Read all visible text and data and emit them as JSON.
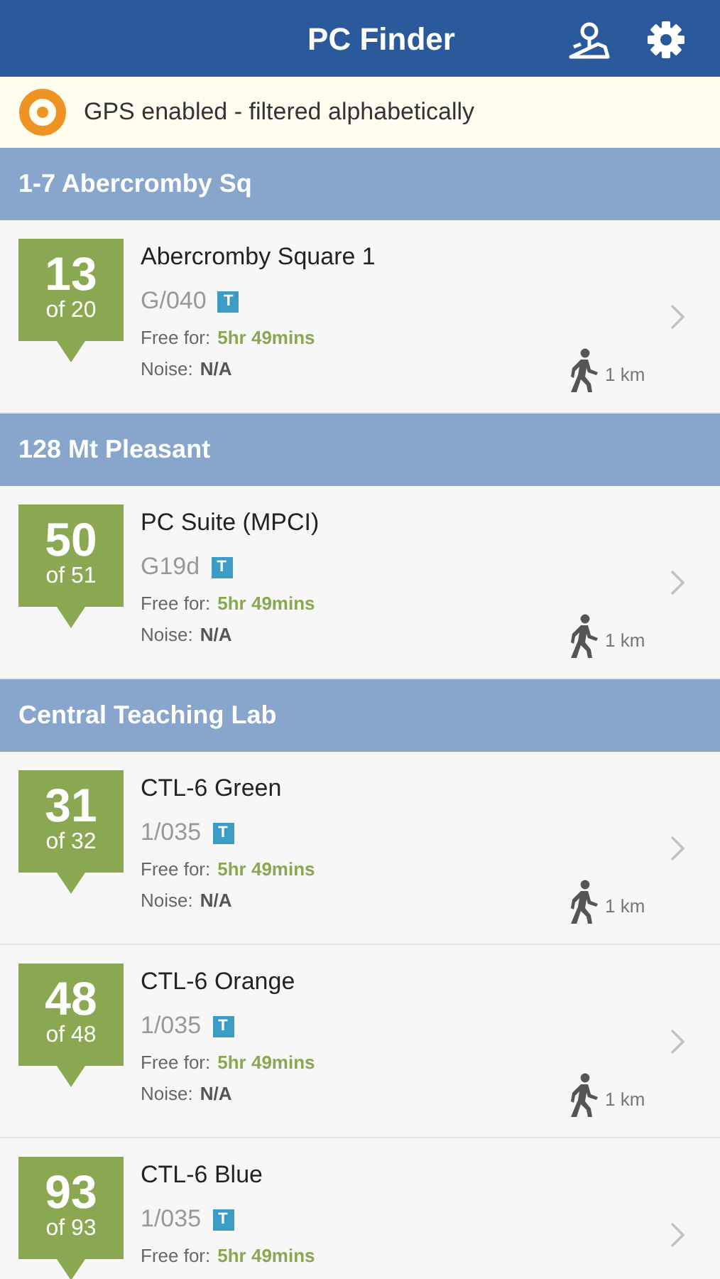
{
  "header": {
    "title": "PC Finder"
  },
  "banner": {
    "text": "GPS enabled - filtered alphabetically"
  },
  "sections": [
    {
      "title": "1-7 Abercromby Sq",
      "rooms": [
        {
          "count": "13",
          "total": "of 20",
          "name": "Abercromby Square 1",
          "room": "G/040",
          "tag": "T",
          "free_label": "Free for:",
          "free_value": "5hr 49mins",
          "noise_label": "Noise:",
          "noise_value": "N/A",
          "distance": "1 km"
        }
      ]
    },
    {
      "title": "128 Mt Pleasant",
      "rooms": [
        {
          "count": "50",
          "total": "of 51",
          "name": "PC Suite (MPCI)",
          "room": "G19d",
          "tag": "T",
          "free_label": "Free for:",
          "free_value": "5hr 49mins",
          "noise_label": "Noise:",
          "noise_value": "N/A",
          "distance": "1 km"
        }
      ]
    },
    {
      "title": "Central Teaching Lab",
      "rooms": [
        {
          "count": "31",
          "total": "of 32",
          "name": "CTL-6 Green",
          "room": "1/035",
          "tag": "T",
          "free_label": "Free for:",
          "free_value": "5hr 49mins",
          "noise_label": "Noise:",
          "noise_value": "N/A",
          "distance": "1 km"
        },
        {
          "count": "48",
          "total": "of 48",
          "name": "CTL-6 Orange",
          "room": "1/035",
          "tag": "T",
          "free_label": "Free for:",
          "free_value": "5hr 49mins",
          "noise_label": "Noise:",
          "noise_value": "N/A",
          "distance": "1 km"
        },
        {
          "count": "93",
          "total": "of 93",
          "name": "CTL-6 Blue",
          "room": "1/035",
          "tag": "T",
          "free_label": "Free for:",
          "free_value": "5hr 49mins"
        }
      ]
    }
  ]
}
